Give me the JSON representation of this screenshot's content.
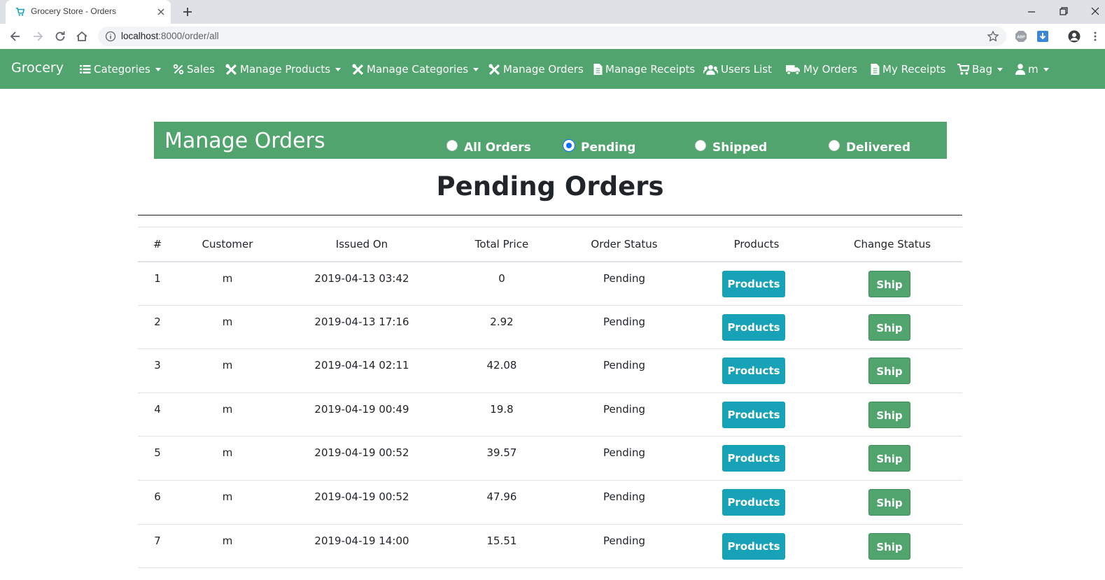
{
  "browser": {
    "tab_title": "Grocery Store - Orders",
    "url_host": "localhost",
    "url_rest": ":8000/order/all",
    "ext_abp_label": "ABP"
  },
  "navbar": {
    "brand": "Grocery",
    "items": [
      {
        "label": "Categories",
        "icon": "list-icon",
        "dropdown": true
      },
      {
        "label": "Sales",
        "icon": "percent-icon",
        "dropdown": false
      },
      {
        "label": "Manage Products",
        "icon": "tools-icon",
        "dropdown": true
      },
      {
        "label": "Manage Categories",
        "icon": "tools-icon",
        "dropdown": true
      },
      {
        "label": "Manage Orders",
        "icon": "tools-icon",
        "dropdown": false
      },
      {
        "label": "Manage Receipts",
        "icon": "file-icon",
        "dropdown": false
      },
      {
        "label": "Users List",
        "icon": "users-icon",
        "dropdown": false
      },
      {
        "label": "My Orders",
        "icon": "truck-icon",
        "dropdown": false
      },
      {
        "label": "My Receipts",
        "icon": "file-icon",
        "dropdown": false
      },
      {
        "label": "Bag",
        "icon": "cart-icon",
        "dropdown": true
      },
      {
        "label": "m",
        "icon": "user-icon",
        "dropdown": true
      }
    ]
  },
  "manage": {
    "title": "Manage Orders",
    "filters": [
      {
        "label": "All Orders",
        "checked": false
      },
      {
        "label": "Pending",
        "checked": true
      },
      {
        "label": "Shipped",
        "checked": false
      },
      {
        "label": "Delivered",
        "checked": false
      }
    ]
  },
  "page_heading": "Pending Orders",
  "table": {
    "headers": [
      "#",
      "Customer",
      "Issued On",
      "Total Price",
      "Order Status",
      "Products",
      "Change Status"
    ],
    "products_label": "Products",
    "ship_label": "Ship",
    "rows": [
      {
        "id": "1",
        "customer": "m",
        "issued": "2019-04-13 03:42",
        "total": "0",
        "status": "Pending"
      },
      {
        "id": "2",
        "customer": "m",
        "issued": "2019-04-13 17:16",
        "total": "2.92",
        "status": "Pending"
      },
      {
        "id": "3",
        "customer": "m",
        "issued": "2019-04-14 02:11",
        "total": "42.08",
        "status": "Pending"
      },
      {
        "id": "4",
        "customer": "m",
        "issued": "2019-04-19 00:49",
        "total": "19.8",
        "status": "Pending"
      },
      {
        "id": "5",
        "customer": "m",
        "issued": "2019-04-19 00:52",
        "total": "39.57",
        "status": "Pending"
      },
      {
        "id": "6",
        "customer": "m",
        "issued": "2019-04-19 00:52",
        "total": "47.96",
        "status": "Pending"
      },
      {
        "id": "7",
        "customer": "m",
        "issued": "2019-04-19 14:00",
        "total": "15.51",
        "status": "Pending"
      }
    ]
  },
  "colors": {
    "navbar": "#51a46e",
    "products_button": "#17a2b8",
    "ship_button": "#51a46e"
  }
}
